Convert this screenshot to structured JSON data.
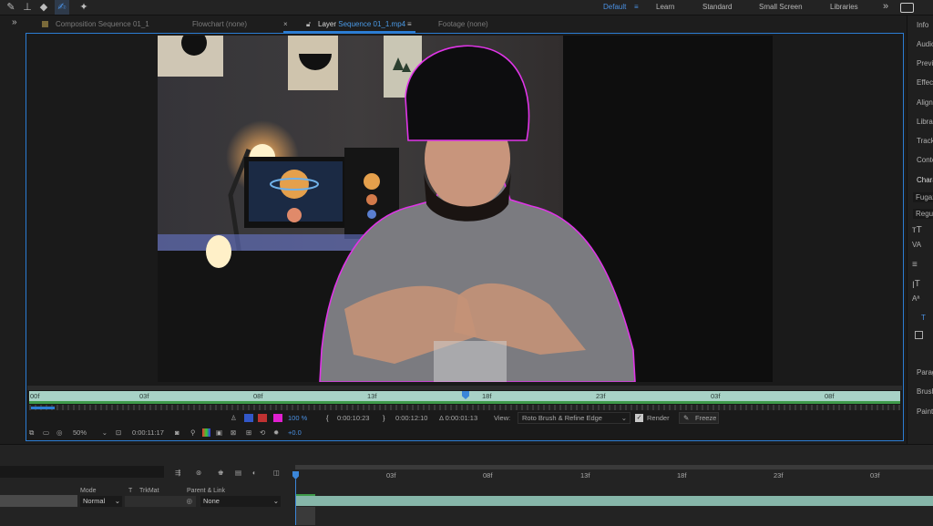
{
  "toolbar": {
    "tools": [
      "pen-tool-icon",
      "stamp-tool-icon",
      "eraser-tool-icon",
      "roto-brush-tool-icon",
      "puppet-pin-tool-icon"
    ],
    "workspaces": [
      "Default",
      "Learn",
      "Standard",
      "Small Screen",
      "Libraries"
    ],
    "more": "»"
  },
  "tabs": {
    "collapse": "»",
    "composition": "Composition Sequence 01_1",
    "flowchart": "Flowchart (none)",
    "layer_prefix": "Layer",
    "layer_name": "Sequence 01_1.mp4",
    "footage": "Footage (none)"
  },
  "right_panel": {
    "items": [
      "Info",
      "Audio",
      "Preview",
      "Effects",
      "Align",
      "Libraries",
      "Tracker",
      "Content",
      "Character"
    ],
    "font": "Fugaz",
    "style": "Regular",
    "lower_items": [
      "Paragraph",
      "Brushes",
      "Paint"
    ]
  },
  "layer_ruler": {
    "ticks": [
      "00f",
      "03f",
      "08f",
      "13f",
      "18f",
      "23f",
      "03f",
      "08f"
    ]
  },
  "layer_controls": {
    "percent": "100 %",
    "in_time": "0:00:10:23",
    "out_time": "0:00:12:10",
    "duration": "Δ 0:00:01:13",
    "view_label": "View:",
    "view_value": "Roto Brush & Refine Edge",
    "render": "Render",
    "freeze": "Freeze"
  },
  "bottom_controls": {
    "zoom": "50%",
    "timecode": "0:00:11:17",
    "exposure": "+0.0"
  },
  "timeline": {
    "headers": {
      "mode": "Mode",
      "t": "T",
      "trkmat": "TrkMat",
      "parent": "Parent & Link"
    },
    "mode_value": "Normal",
    "parent_value": "None",
    "ticks": [
      "03f",
      "08f",
      "13f",
      "18f",
      "23f",
      "03f"
    ]
  },
  "colors": {
    "accent": "#2c7dd4",
    "ruler": "#a8d2c6",
    "roto": "#e035e8"
  }
}
